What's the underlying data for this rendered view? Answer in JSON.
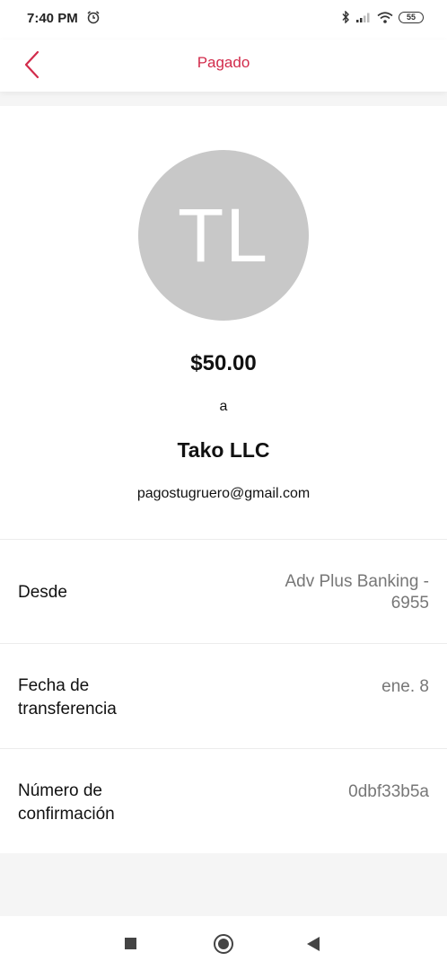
{
  "status_bar": {
    "time": "7:40 PM",
    "battery": "55"
  },
  "header": {
    "title": "Pagado"
  },
  "payment": {
    "avatar_initials": "TL",
    "amount": "$50.00",
    "to_word": "a",
    "payee_name": "Tako LLC",
    "payee_email": "pagostugruero@gmail.com"
  },
  "details": [
    {
      "label_lines": [
        "Desde"
      ],
      "value_lines": [
        "Adv Plus Banking -",
        "6955"
      ]
    },
    {
      "label_lines": [
        "Fecha de",
        "transferencia"
      ],
      "value_lines": [
        "ene. 8"
      ]
    },
    {
      "label_lines": [
        "Número de",
        "confirmación"
      ],
      "value_lines": [
        "0dbf33b5a"
      ]
    }
  ],
  "colors": {
    "accent": "#d22b4b",
    "avatar_bg": "#c8c8c8",
    "secondary_text": "#777777"
  },
  "icons": {
    "back": "chevron-left-icon",
    "alarm": "alarm-clock-icon"
  }
}
